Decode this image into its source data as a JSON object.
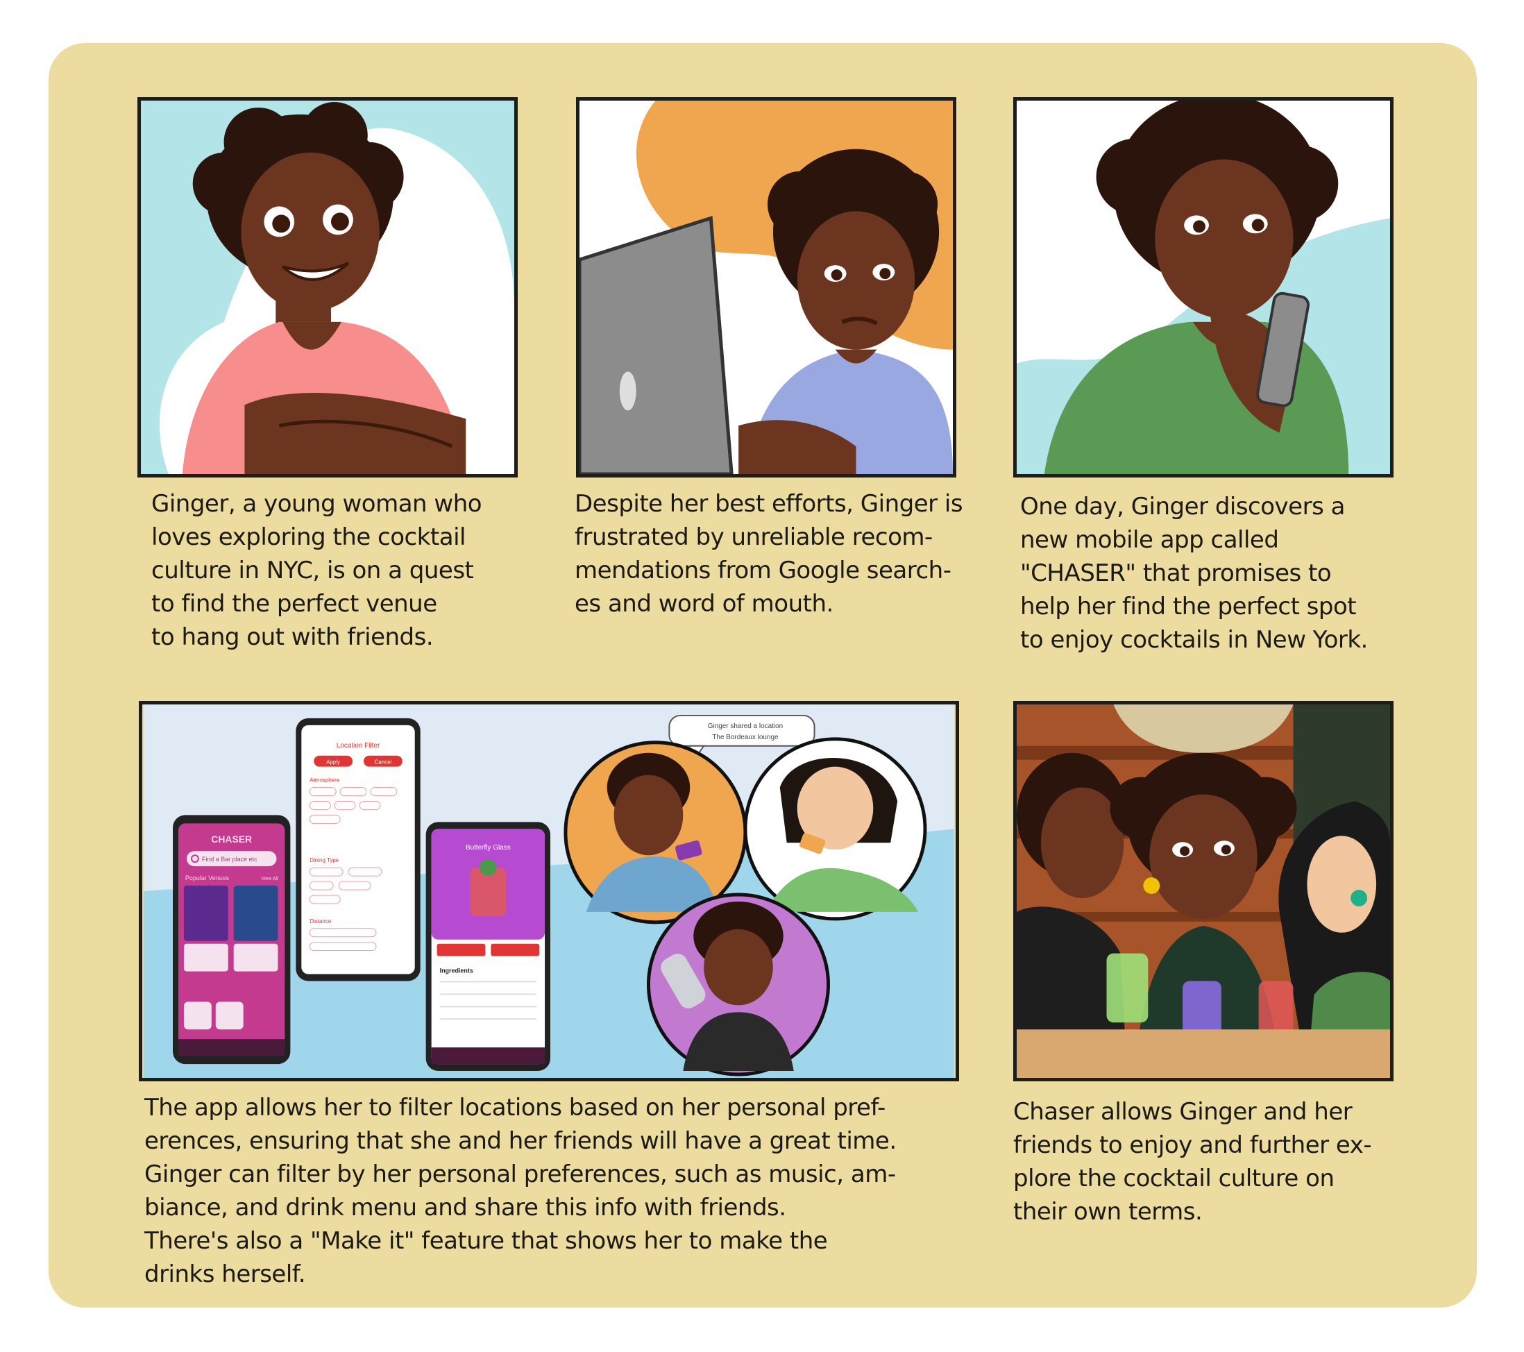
{
  "panels": [
    {
      "id": "panel-1",
      "caption_lines": [
        "Ginger, a young woman who",
        "loves exploring the cocktail",
        "culture in NYC, is on a quest",
        "to find the perfect venue",
        "to hang out with friends."
      ]
    },
    {
      "id": "panel-2",
      "caption_lines": [
        "Despite her best efforts, Ginger is",
        "frustrated by unreliable recom-",
        "mendations from Google search-",
        "es and word of mouth."
      ]
    },
    {
      "id": "panel-3",
      "caption_lines": [
        "One day, Ginger discovers a",
        "new mobile app called",
        "\"CHASER\" that promises to",
        "help her find the perfect spot",
        "to enjoy cocktails in New York."
      ]
    },
    {
      "id": "panel-4",
      "caption_lines": [
        "The app allows her to filter locations based on her personal pref-",
        "erences, ensuring that she and her friends will have a great time.",
        "Ginger can filter by her personal preferences, such as music, am-",
        "biance, and drink menu and share this info with friends.",
        "There's also a \"Make it\" feature that shows her to make the",
        "drinks herself."
      ],
      "phone_left": {
        "brand": "CHASER",
        "search_placeholder": "Find a Bar place etc",
        "section": "Popular Venues",
        "see_all": "View All"
      },
      "phone_center": {
        "title": "Location Filter",
        "apply": "Apply",
        "cancel": "Cancel",
        "groups": [
          "Atmosphere",
          "Dining Type",
          "Distance"
        ]
      },
      "phone_right": {
        "drink_name": "Butterfly Glass",
        "ingredients_label": "Ingredients"
      },
      "share_bubble": [
        "Ginger shared a location",
        "The Bordeaux lounge"
      ]
    },
    {
      "id": "panel-5",
      "caption_lines": [
        "Chaser allows Ginger and her",
        "friends to enjoy and further ex-",
        "plore the cocktail culture on",
        "their own terms."
      ]
    }
  ],
  "colors": {
    "board": "#ecdca0",
    "skin": "#6b3520",
    "hair": "#2b140c",
    "panel1_bg": "#b2e4e8",
    "panel2_bg": "#f0a64e",
    "panel5_bg": "#a8542a",
    "app_pink": "#e8367a",
    "app_red": "#e03535"
  }
}
